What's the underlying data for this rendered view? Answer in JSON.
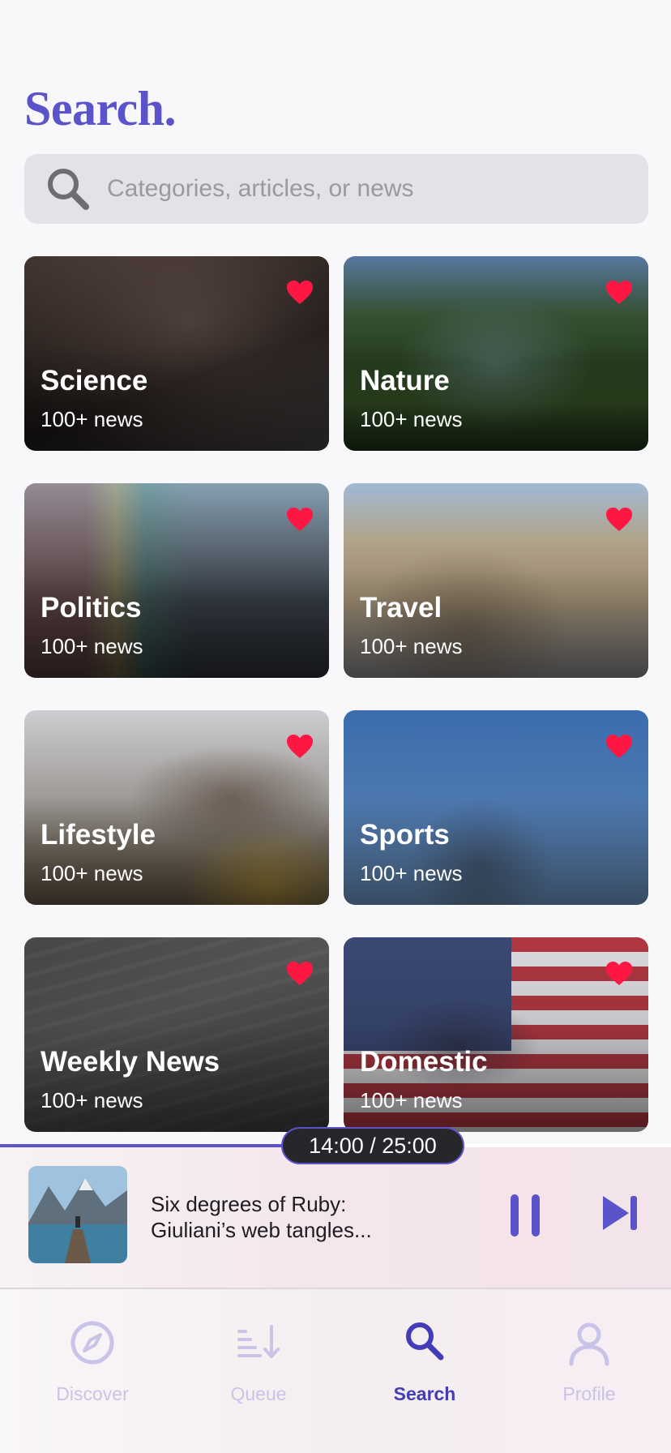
{
  "header": {
    "title": "Search."
  },
  "search": {
    "placeholder": "Categories, articles, or news",
    "icon": "search-icon"
  },
  "categories": [
    {
      "name": "Science",
      "count": "100+ news",
      "favorite": true
    },
    {
      "name": "Nature",
      "count": "100+ news",
      "favorite": true
    },
    {
      "name": "Politics",
      "count": "100+ news",
      "favorite": true
    },
    {
      "name": "Travel",
      "count": "100+ news",
      "favorite": true
    },
    {
      "name": "Lifestyle",
      "count": "100+ news",
      "favorite": true
    },
    {
      "name": "Sports",
      "count": "100+ news",
      "favorite": true
    },
    {
      "name": "Weekly News",
      "count": "100+ news",
      "favorite": true
    },
    {
      "name": "Domestic",
      "count": "100+ news",
      "favorite": true
    }
  ],
  "player": {
    "time": "14:00 / 25:00",
    "progress": 0.56,
    "title": "Six degrees of Ruby: Giuliani’s web tangles...",
    "controls": [
      "pause-icon",
      "skip-next-icon"
    ]
  },
  "tabs": [
    {
      "label": "Discover",
      "icon": "compass-icon",
      "active": false
    },
    {
      "label": "Queue",
      "icon": "queue-icon",
      "active": false
    },
    {
      "label": "Search",
      "icon": "search-icon",
      "active": true
    },
    {
      "label": "Profile",
      "icon": "profile-icon",
      "active": false
    }
  ],
  "colors": {
    "accent": "#5a53c9",
    "heart": "#ff1744",
    "active_tab": "#433db5",
    "inactive_tab": "#c9c3e8"
  }
}
